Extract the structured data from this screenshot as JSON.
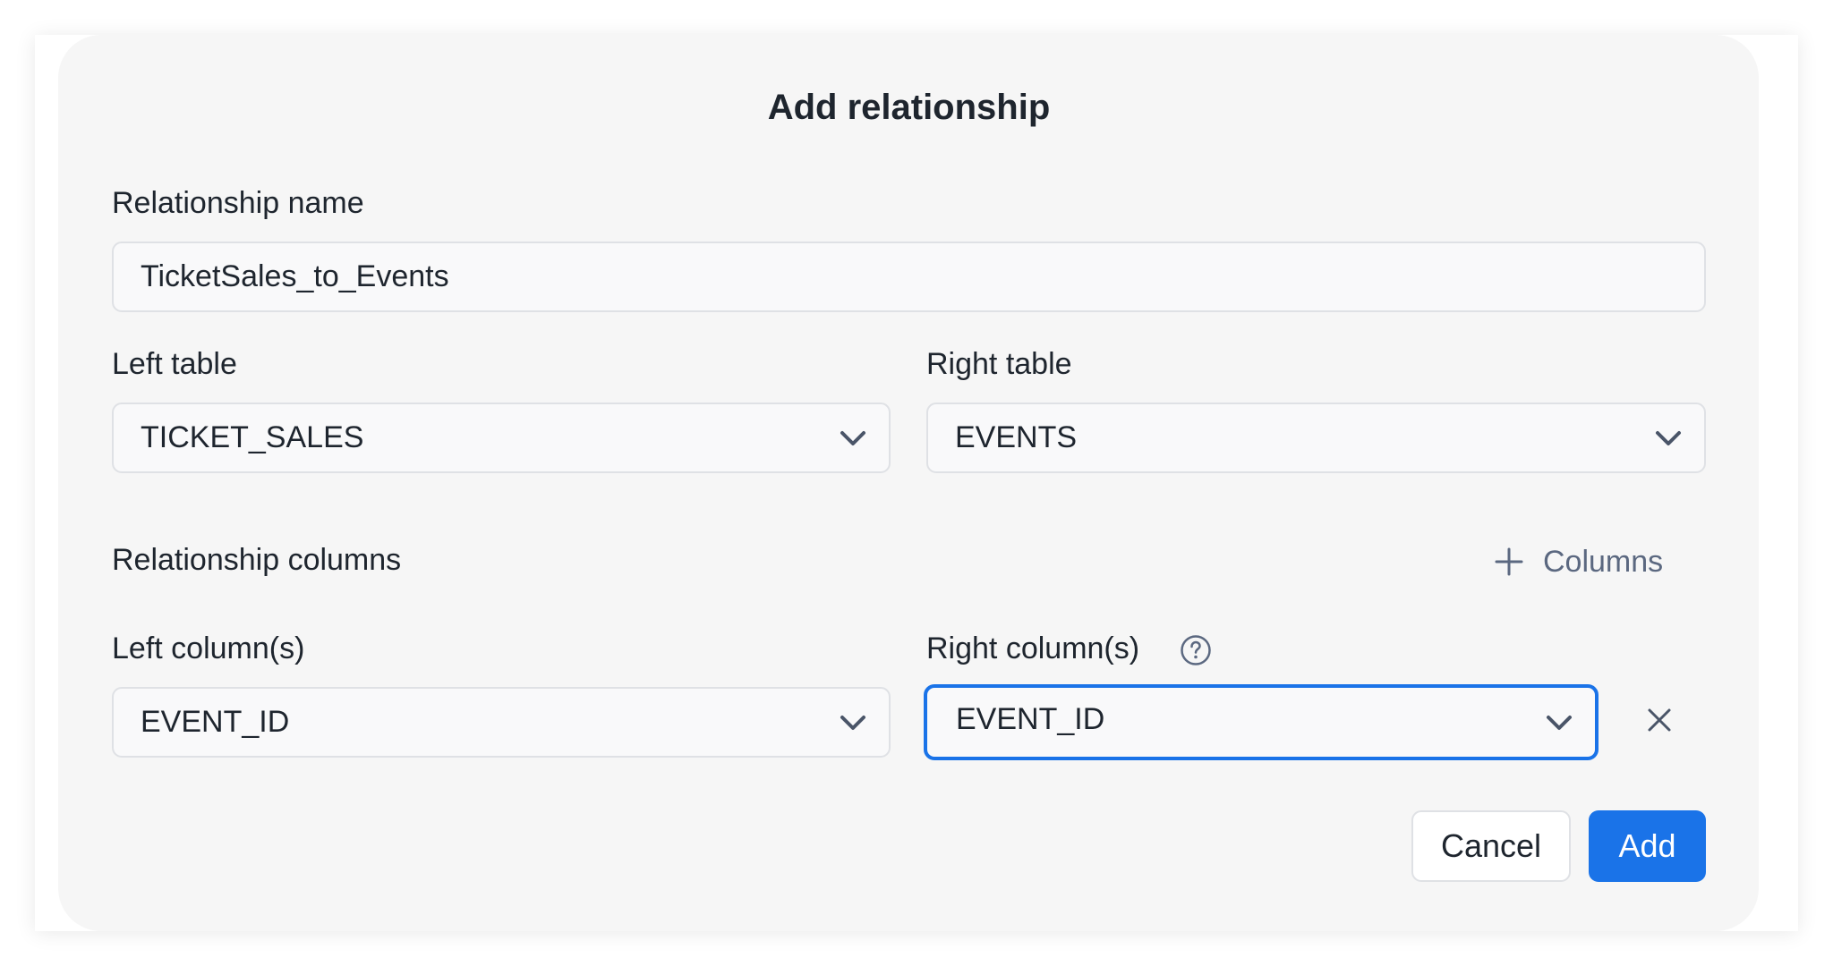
{
  "dialog": {
    "title": "Add relationship"
  },
  "relationship_name": {
    "label": "Relationship name",
    "value": "TicketSales_to_Events"
  },
  "left_table": {
    "label": "Left table",
    "value": "TICKET_SALES"
  },
  "right_table": {
    "label": "Right table",
    "value": "EVENTS"
  },
  "relationship_columns": {
    "heading": "Relationship columns",
    "add_label": "Columns",
    "left_column": {
      "label": "Left column(s)",
      "value": "EVENT_ID"
    },
    "right_column": {
      "label": "Right column(s)",
      "value": "EVENT_ID",
      "help_icon": "question-circle-icon"
    }
  },
  "actions": {
    "cancel_label": "Cancel",
    "add_label": "Add"
  },
  "colors": {
    "accent": "#1a73e8",
    "dialog_background": "#f6f6f6",
    "text": "#1e252e",
    "muted_text": "#5b6880"
  }
}
